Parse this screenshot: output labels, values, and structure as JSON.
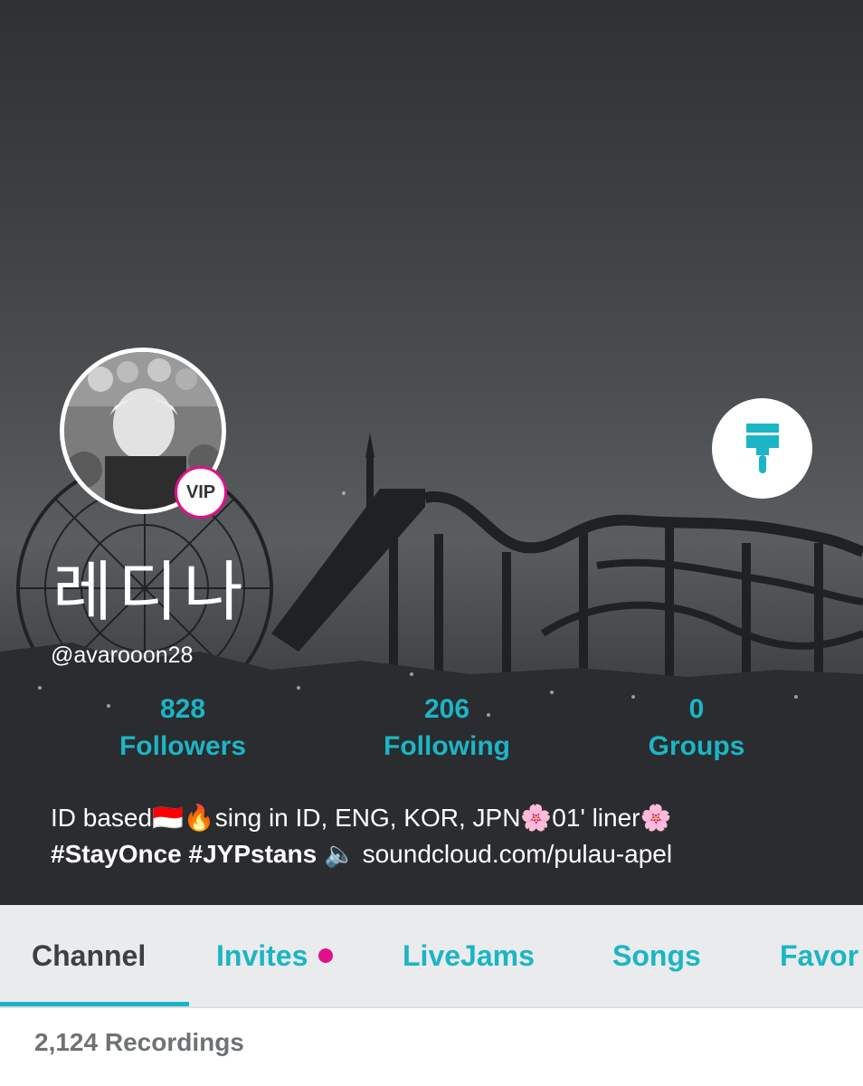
{
  "profile": {
    "display_name": "레디나",
    "handle": "@avarooon28",
    "badge": "VIP"
  },
  "stats": [
    {
      "count": "828",
      "label": "Followers"
    },
    {
      "count": "206",
      "label": "Following"
    },
    {
      "count": "0",
      "label": "Groups"
    }
  ],
  "bio": {
    "line1": "ID based🇮🇩🔥sing in ID, ENG, KOR, JPN🌸01' liner🌸",
    "tags": "#StayOnce #JYPstans",
    "speaker": "🔈",
    "link": "soundcloud.com/pulau-apel"
  },
  "tabs": [
    {
      "label": "Channel"
    },
    {
      "label": "Invites"
    },
    {
      "label": "LiveJams"
    },
    {
      "label": "Songs"
    },
    {
      "label": "Favor"
    }
  ],
  "recordings_label": "2,124 Recordings",
  "icons": {
    "edit": "paint-brush-icon",
    "notification": "pink-dot"
  },
  "colors": {
    "accent": "#1cb5c5",
    "vip": "#e0108a",
    "active_tab_text": "#3d4043"
  }
}
